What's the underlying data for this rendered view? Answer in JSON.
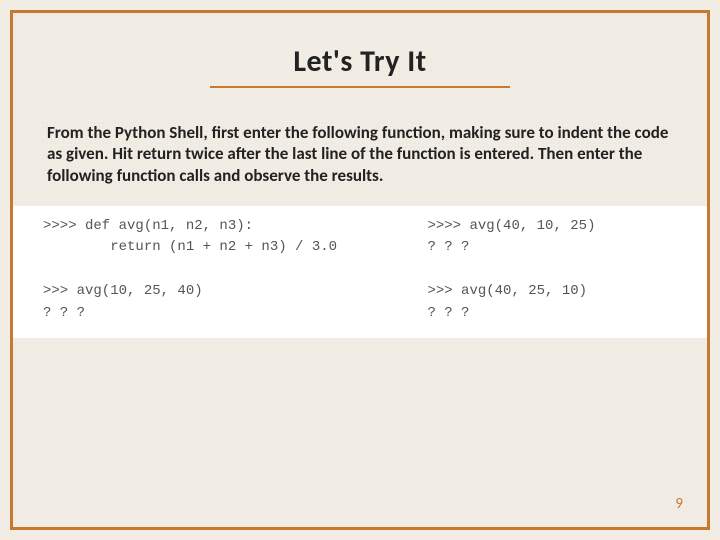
{
  "slide": {
    "title": "Let's Try It",
    "body": "From the Python Shell, first enter the following function, making sure to indent the code as given. Hit return twice after the last line of the function is entered. Then enter the following function calls and observe the results.",
    "page_number": "9"
  },
  "code": {
    "left": ">>>> def avg(n1, n2, n3):\n        return (n1 + n2 + n3) / 3.0\n\n>>> avg(10, 25, 40)\n? ? ?",
    "right": ">>>> avg(40, 10, 25)\n? ? ?\n\n>>> avg(40, 25, 10)\n? ? ?"
  }
}
